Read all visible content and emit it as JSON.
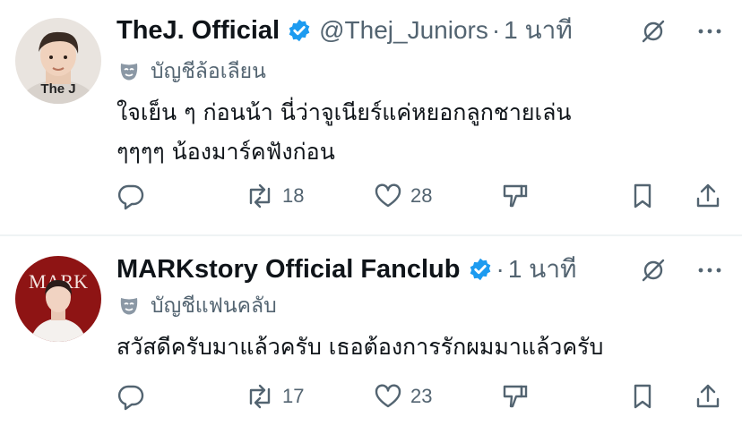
{
  "tweets": [
    {
      "display_name": "TheJ. Official",
      "handle": "@Thej_Juniors",
      "separator": "·",
      "time": "1 นาที",
      "label": "บัญชีล้อเลียน",
      "text_lines": [
        "ใจเย็น ๆ ก่อนน้า นี่ว่าจูเนียร์แค่หยอกลูกชายเล่น",
        "ๆๆๆๆ น้องมาร์คฟังก่อน"
      ],
      "avatar_caption": "The J",
      "retweets": "18",
      "likes": "28",
      "verified_color": "#1d9bf0"
    },
    {
      "display_name": "MARKstory Official Fanclub",
      "handle": "",
      "separator": "·",
      "time": "1 นาที",
      "label": "บัญชีแฟนคลับ",
      "text_lines": [
        "สวัสดีครับมาแล้วครับ เธอต้องการรักผมมาแล้วครับ"
      ],
      "avatar_caption": "MARK",
      "retweets": "17",
      "likes": "23",
      "verified_color": "#1d9bf0"
    }
  ],
  "icons": {
    "reply": "reply-icon",
    "retweet": "retweet-icon",
    "like": "heart-icon",
    "dislike": "downvote-icon",
    "bookmark": "bookmark-icon",
    "share": "share-icon",
    "mute": "mute-icon",
    "more": "more-icon",
    "label": "parody-mask-icon"
  },
  "colors": {
    "text": "#0f1419",
    "secondary": "#536471",
    "accent": "#1d9bf0",
    "divider": "#eff3f4"
  }
}
